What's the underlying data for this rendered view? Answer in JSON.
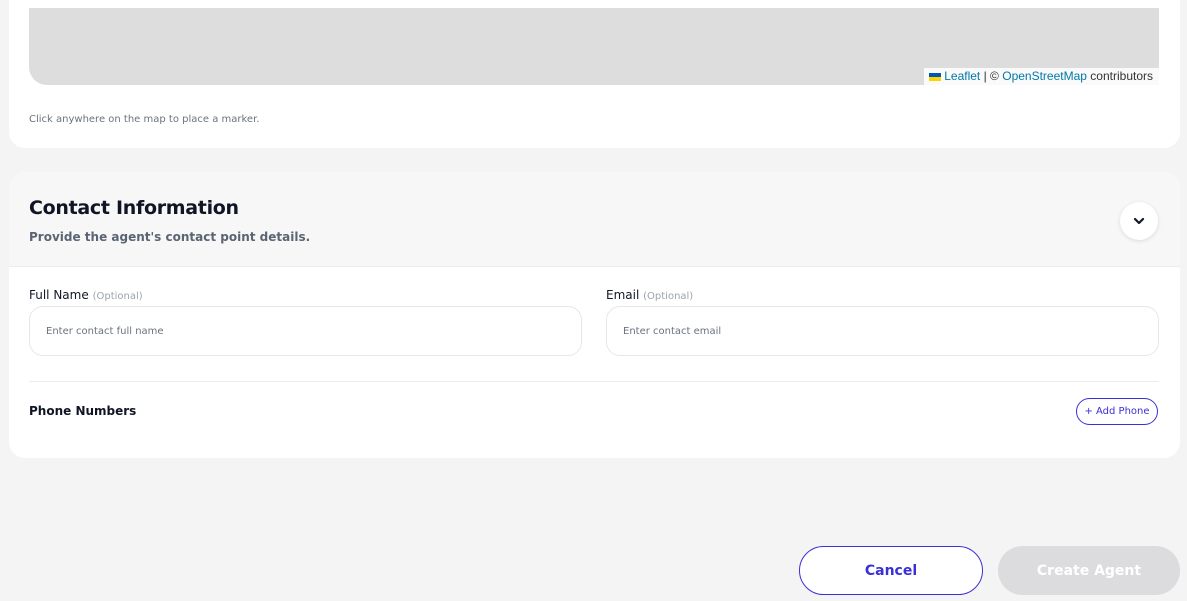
{
  "map": {
    "attribution": {
      "leaflet": "Leaflet",
      "separator": "| ©",
      "osm": "OpenStreetMap",
      "contributors": "contributors"
    },
    "hint": "Click anywhere on the map to place a marker."
  },
  "contact": {
    "title": "Contact Information",
    "subtitle": "Provide the agent's contact point details.",
    "collapse_icon": "chevron-down-icon",
    "full_name": {
      "label": "Full Name",
      "optional": "(Optional)",
      "value": "",
      "placeholder": "Enter contact full name"
    },
    "email": {
      "label": "Email",
      "optional": "(Optional)",
      "value": "",
      "placeholder": "Enter contact email"
    },
    "phone": {
      "label": "Phone Numbers",
      "add_button": "+ Add Phone"
    }
  },
  "footer": {
    "cancel": "Cancel",
    "create": "Create Agent"
  },
  "colors": {
    "accent": "#3b2fd6",
    "disabled_button": "#dcdcde",
    "map_background": "#dddddd",
    "link": "#0078a8"
  }
}
